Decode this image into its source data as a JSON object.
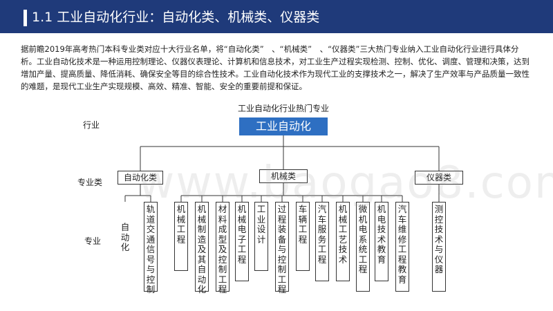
{
  "header": {
    "title": "1.1 工业自动化行业：自动化类、机械类、仪器类",
    "accent_color": "#1f3a7a"
  },
  "paragraph": "据前瞻2019年高考热门本科专业类对应十大行业名单，将“自动化类”　、“机械类”　、“仪器类”三大热门专业纳入工业自动化行业进行具体分析。工业自动化技术是一种运用控制理论、仪器仪表理论、计算机和信息技术，对工业生产过程实现检测、控制、优化、调度、管理和决策，达到增加产量、提高质量、降低消耗、确保安全等目的综合性技术。工业自动化技术作为现代工业的支撑技术之一，解决了生产效率与产品质量一致性的难题，是现代工业生产实现规模、高效、精准、智能、安全的重要前提和保证。",
  "diagram": {
    "title": "工业自动化行业热门专业",
    "row_labels": {
      "industry": "行业",
      "category": "专业类",
      "major": "专业"
    },
    "root": "工业自动化",
    "categories": [
      "自动化类",
      "机械类",
      "仪器类"
    ],
    "leaves": [
      "自动化",
      "轨道交通信号与控制",
      "机械工程",
      "机械制造及其自动化",
      "材料成型及控制工程",
      "机械电子工程",
      "工业设计",
      "过程装备与控制工程",
      "车辆工程",
      "汽车服务工程",
      "机械工艺技术",
      "微机电系统工程",
      "机电技术教育",
      "汽车维修工程教育",
      "测控技术与仪器"
    ],
    "root_color": "#2e6fc2"
  },
  "watermark": "www.baogao8.com"
}
